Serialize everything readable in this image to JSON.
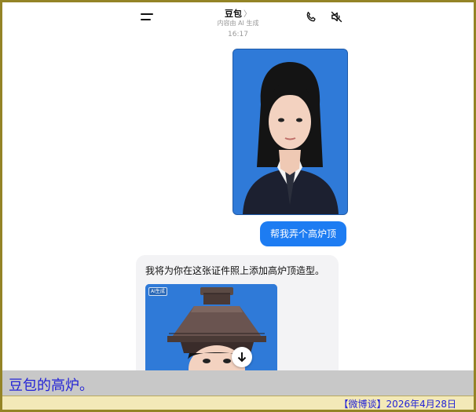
{
  "header": {
    "title": "豆包",
    "title_chevron": "〉",
    "subtitle": "内容由 AI 生成",
    "icons": [
      "menu-icon",
      "phone-icon",
      "mute-icon"
    ]
  },
  "chat": {
    "time": "16:17",
    "user_message": "帮我弄个高炉顶",
    "bot_message": "我将为你在这张证件照上添加高炉顶造型。",
    "ai_badge": "AI生成"
  },
  "caption": {
    "text": "豆包的高炉。",
    "credit": "【微博谈】2026年4月28日"
  },
  "colors": {
    "frame": "#948426",
    "photo_bg": "#2f7ad8",
    "user_bubble": "#1d7cf2",
    "caption_text": "#2323d6"
  }
}
